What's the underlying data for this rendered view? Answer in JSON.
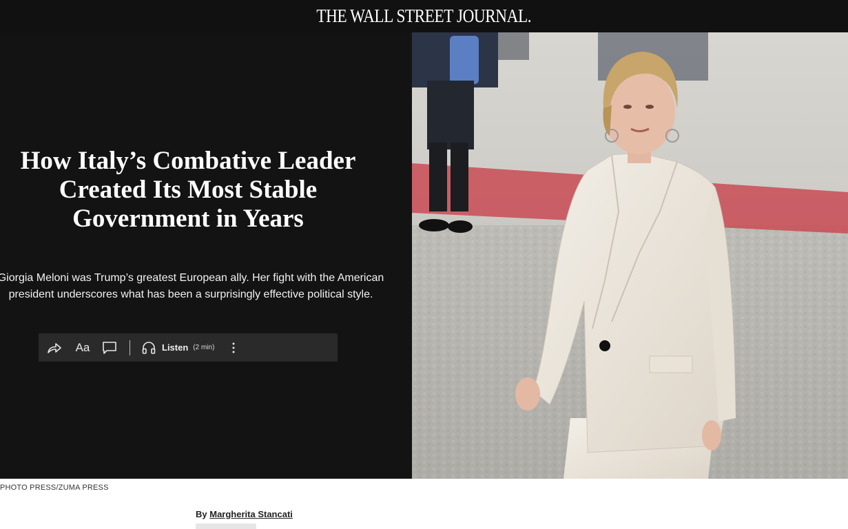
{
  "site": {
    "masthead": "THE WALL STREET JOURNAL."
  },
  "article": {
    "headline": "How Italy’s Combative Leader Created Its Most Stable Government in Years",
    "dek": "Giorgia Meloni was Trump’s greatest European ally. Her fight with the American president underscores what has been a surprisingly effective political style.",
    "photo_credit": "PHOTO PRESS/ZUMA PRESS",
    "byline_prefix": "By",
    "author": "Margherita Stancati"
  },
  "toolbar": {
    "share_icon": "share-icon",
    "text_size_label": "Aa",
    "comment_icon": "comment-icon",
    "listen_icon": "headphones-icon",
    "listen_label": "Listen",
    "listen_duration": "(2 min)",
    "more_icon": "more-vertical-icon"
  },
  "colors": {
    "topbar": "#111111",
    "hero_background": "#131313",
    "toolbar_background": "#2a2a2a",
    "carpet_red": "#c94b55",
    "suit_cream": "#ece6dc"
  }
}
